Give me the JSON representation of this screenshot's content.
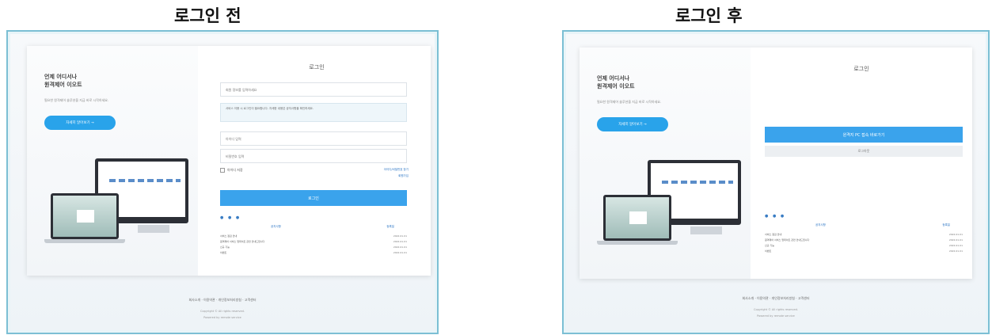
{
  "headings": {
    "before": "로그인 전",
    "after": "로그인 후"
  },
  "colors": {
    "accent": "#3aa3ec",
    "frame_border": "#7bbfd4",
    "link": "#2a74c4"
  },
  "before": {
    "promo": {
      "title_line1": "언제 어디서나",
      "title_line2": "원격제어 이오트",
      "desc": "필요한 원격제어 솔루션을 지금 바로 시작하세요.",
      "button": "자세히 알아보기 →"
    },
    "login": {
      "title": "로그인",
      "field_top_placeholder": "회원 정보를 입력하세요",
      "notice": "서비스 이용 시 로그인이 필요합니다. 자세한 내용은 공지사항을 확인하세요.",
      "id_placeholder": "아이디 입력",
      "pw_placeholder": "비밀번호 입력",
      "remember": "아이디 저장",
      "link1": "아이디/비밀번호 찾기",
      "link2": "회원가입",
      "login_button": "로그인",
      "dots": "● ● ●",
      "board_head_left": "공지사항",
      "board_head_right": "등록일",
      "rows": [
        {
          "title": "서비스 점검 안내",
          "date": "2022.01.01"
        },
        {
          "title": "원격제어 서비스 업데이트 관련 안내드립니다",
          "date": "2022.01.01"
        },
        {
          "title": "신규 기능",
          "date": "2022.01.01"
        },
        {
          "title": "이벤트",
          "date": "2022.01.01"
        }
      ]
    },
    "footer_line1": "회사소개 · 이용약관 · 개인정보처리방침 · 고객센터",
    "footer_line2": "Copyright © All rights reserved.",
    "footer_line3": "Powered by remote service"
  },
  "after": {
    "promo": {
      "title_line1": "언제 어디서나",
      "title_line2": "원격제어 이오트",
      "desc": "필요한 원격제어 솔루션을 지금 바로 시작하세요.",
      "button": "자세히 알아보기 →"
    },
    "login": {
      "title": "로그인",
      "main_button": "원격지 PC 접속 바로가기",
      "sub_button": "로그아웃",
      "dots": "● ● ●",
      "board_head_left": "공지사항",
      "board_head_right": "등록일",
      "rows": [
        {
          "title": "서비스 점검 안내",
          "date": "2022.01.01"
        },
        {
          "title": "원격제어 서비스 업데이트 관련 안내드립니다",
          "date": "2022.01.01"
        },
        {
          "title": "신규 기능",
          "date": "2022.01.01"
        },
        {
          "title": "이벤트",
          "date": "2022.01.01"
        }
      ]
    },
    "footer_line1": "회사소개 · 이용약관 · 개인정보처리방침 · 고객센터",
    "footer_line2": "Copyright © All rights reserved.",
    "footer_line3": "Powered by remote service"
  }
}
